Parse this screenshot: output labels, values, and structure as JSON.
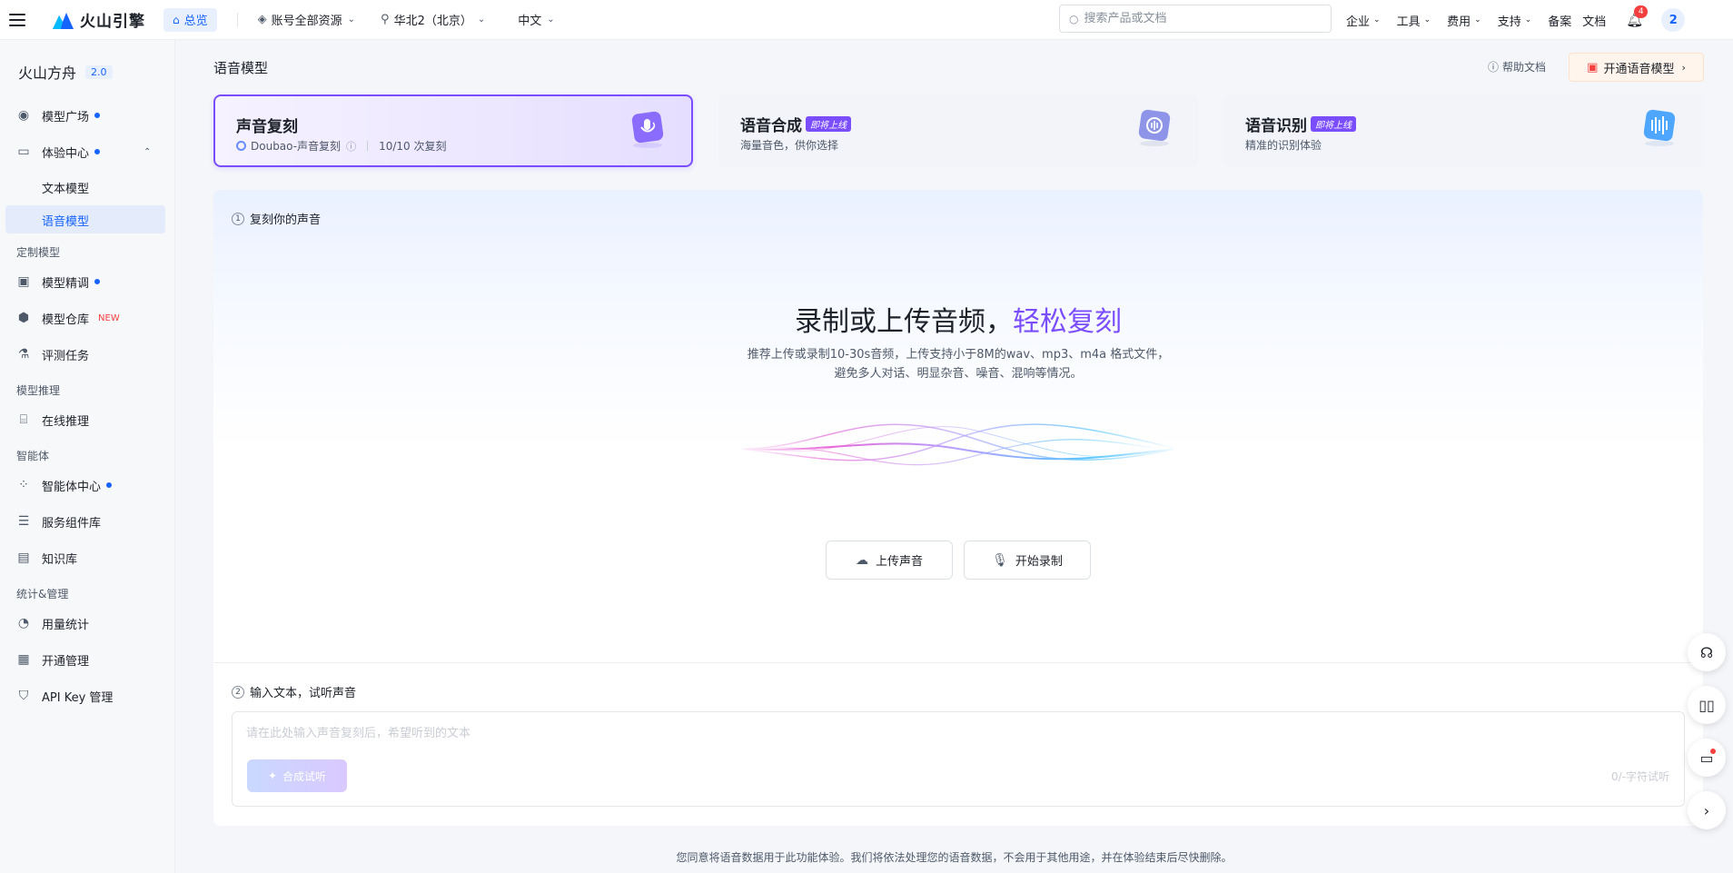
{
  "topbar": {
    "logo_text": "火山引擎",
    "home_tab": "总览",
    "account_select": "账号全部资源",
    "region_select": "华北2（北京）",
    "language_select": "中文",
    "search_placeholder": "搜索产品或文档",
    "menus": [
      "企业",
      "工具",
      "费用",
      "支持"
    ],
    "beian": "备案",
    "docs": "文档",
    "notification_count": "4",
    "avatar_text": "2"
  },
  "sidebar": {
    "title": "火山方舟",
    "version": "2.0",
    "model_square": "模型广场",
    "experience_center": "体验中心",
    "text_model": "文本模型",
    "voice_model": "语音模型",
    "group_custom": "定制模型",
    "fine_tune": "模型精调",
    "model_repo": "模型仓库",
    "new_tag": "NEW",
    "eval_task": "评测任务",
    "group_inference": "模型推理",
    "online_inference": "在线推理",
    "group_agent": "智能体",
    "agent_center": "智能体中心",
    "service_components": "服务组件库",
    "knowledge_base": "知识库",
    "group_stats": "统计&管理",
    "usage_stats": "用量统计",
    "activation": "开通管理",
    "api_key": "API Key 管理"
  },
  "main": {
    "page_title": "语音模型",
    "help_link": "帮助文档",
    "open_button": "开通语音模型",
    "cards": [
      {
        "title": "声音复刻",
        "model": "Doubao-声音复刻",
        "quota": "10/10 次复刻"
      },
      {
        "title": "语音合成",
        "tag": "即将上线",
        "subtitle": "海量音色，供你选择"
      },
      {
        "title": "语音识别",
        "tag": "即将上线",
        "subtitle": "精准的识别体验"
      }
    ],
    "step1_num": "1",
    "step1_label": "复刻你的声音",
    "hero_title_main": "录制或上传音频，",
    "hero_title_accent": "轻松复刻",
    "hero_desc_line1": "推荐上传或录制10-30s音频，上传支持小于8M的wav、mp3、m4a 格式文件，",
    "hero_desc_line2": "避免多人对话、明显杂音、噪音、混响等情况。",
    "upload_button": "上传声音",
    "record_button": "开始录制",
    "step2_num": "2",
    "step2_label": "输入文本，试听声音",
    "text_placeholder": "请在此处输入声音复刻后，希望听到的文本",
    "synth_button": "合成试听",
    "char_count": "0/-字符试听",
    "footer_note": "您同意将语音数据用于此功能体验。我们将依法处理您的语音数据，不会用于其他用途，并在体验结束后尽快删除。"
  },
  "colors": {
    "accent_blue": "#1664ff",
    "accent_purple": "#7a4dff",
    "badge_red": "#f53f3f"
  }
}
